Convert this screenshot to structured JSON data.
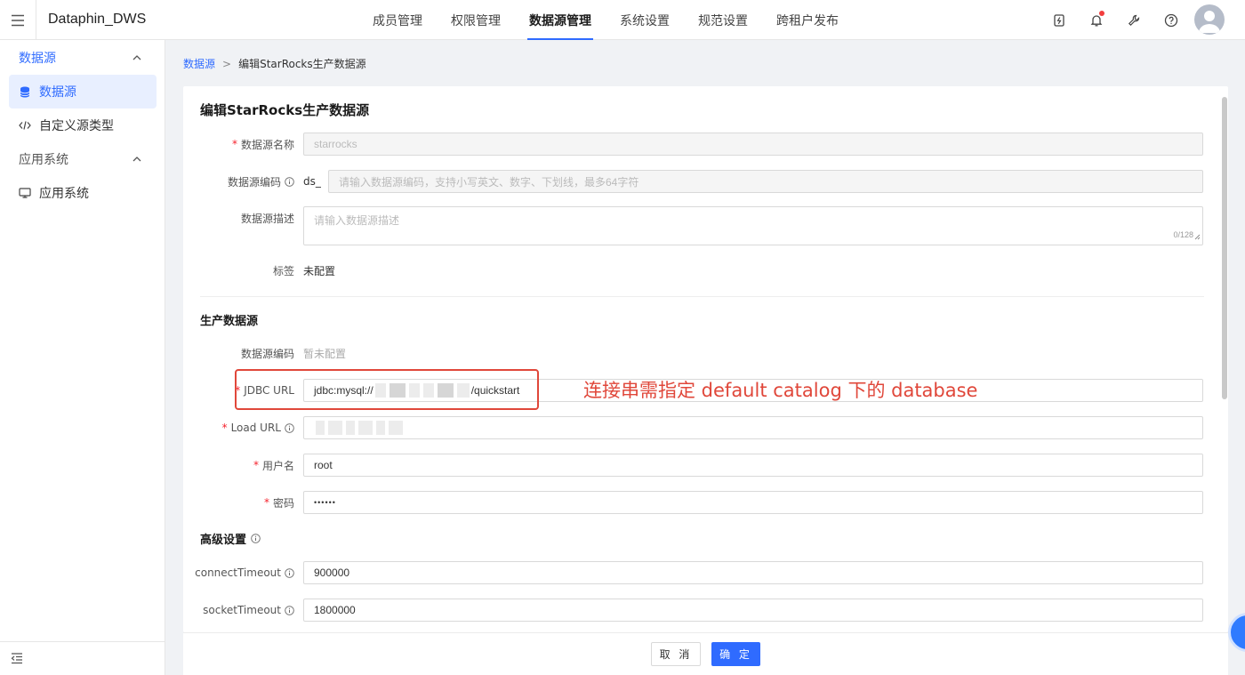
{
  "app": {
    "title": "Dataphin_DWS"
  },
  "nav": {
    "items": [
      "成员管理",
      "权限管理",
      "数据源管理",
      "系统设置",
      "规范设置",
      "跨租户发布"
    ],
    "active": "数据源管理"
  },
  "sidebar": {
    "groups": [
      {
        "label": "数据源",
        "items": [
          {
            "label": "数据源",
            "icon": "database-icon",
            "active": true
          },
          {
            "label": "自定义源类型",
            "icon": "code-icon"
          }
        ]
      },
      {
        "label": "应用系统",
        "items": [
          {
            "label": "应用系统",
            "icon": "monitor-icon"
          }
        ]
      }
    ]
  },
  "breadcrumb": {
    "root": "数据源",
    "separator": ">",
    "current": "编辑StarRocks生产数据源"
  },
  "form": {
    "title": "编辑StarRocks生产数据源",
    "name": {
      "label": "数据源名称",
      "value": "starrocks"
    },
    "code": {
      "label": "数据源编码",
      "prefix": "ds_",
      "placeholder": "请输入数据源编码，支持小写英文、数字、下划线，最多64字符"
    },
    "desc": {
      "label": "数据源描述",
      "placeholder": "请输入数据源描述",
      "counter": "0/128"
    },
    "tag": {
      "label": "标签",
      "value": "未配置"
    },
    "prod_section": "生产数据源",
    "prod_code": {
      "label": "数据源编码",
      "value": "暂未配置"
    },
    "jdbc": {
      "label": "JDBC URL",
      "value_prefix": "jdbc:mysql://",
      "value_suffix": "/quickstart"
    },
    "load_url": {
      "label": "Load URL"
    },
    "username": {
      "label": "用户名",
      "value": "root"
    },
    "password": {
      "label": "密码",
      "value": "••••••"
    },
    "advanced_section": "高级设置",
    "connect_timeout": {
      "label": "connectTimeout",
      "value": "900000"
    },
    "socket_timeout": {
      "label": "socketTimeout",
      "value": "1800000"
    }
  },
  "annotation": {
    "text": "连接串需指定 default catalog 下的 database",
    "color": "#e0473a"
  },
  "footer": {
    "cancel": "取 消",
    "ok": "确 定"
  },
  "colors": {
    "primary": "#2f6bff",
    "required": "#f5222d"
  }
}
